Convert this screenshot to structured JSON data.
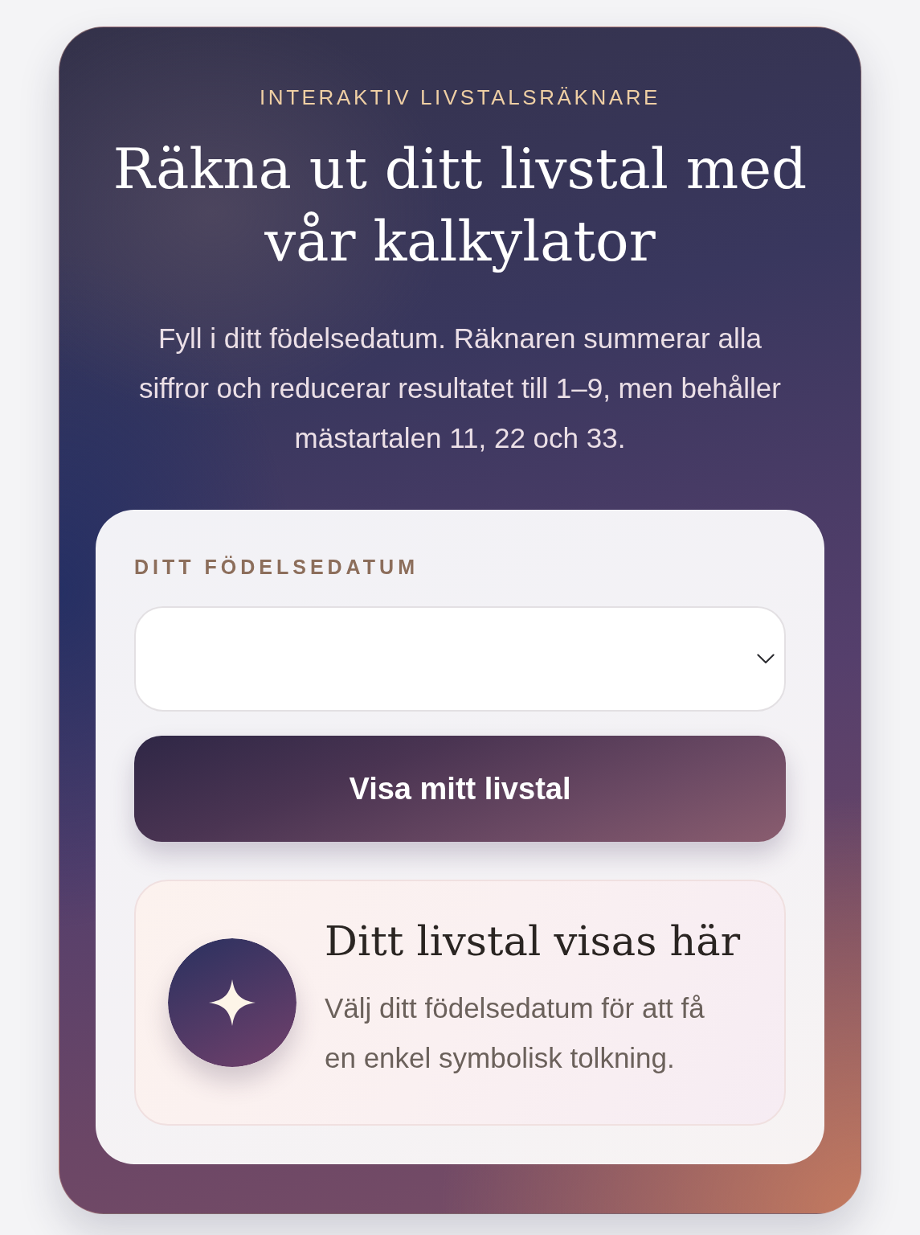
{
  "calculator": {
    "eyebrow": "INTERAKTIV LIVSTALSRÄKNARE",
    "title": "Räkna ut ditt livstal med vår kalkylator",
    "intro": "Fyll i ditt födelsedatum. Räknaren summerar alla siffror och reducerar resultatet till 1–9, men behåller mästartalen 11, 22 och 33.",
    "form": {
      "label": "DITT FÖDELSEDATUM",
      "submit_button": "Visa mitt livstal",
      "result": {
        "heading": "Ditt livstal visas här",
        "text": "Välj ditt födelsedatum för att få en enkel symbolisk tolkning."
      }
    }
  }
}
